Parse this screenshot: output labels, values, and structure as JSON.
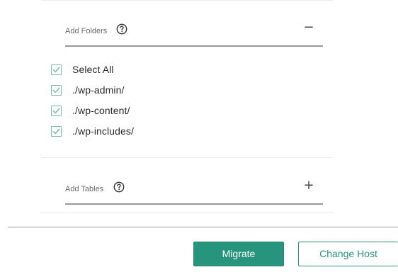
{
  "folders_section": {
    "title": "Add Folders",
    "help_icon": "help-circle-icon",
    "toggle": "−",
    "expanded": true,
    "items": [
      {
        "label": "Select All",
        "checked": true
      },
      {
        "label": "./wp-admin/",
        "checked": true
      },
      {
        "label": "./wp-content/",
        "checked": true
      },
      {
        "label": "./wp-includes/",
        "checked": true
      }
    ]
  },
  "tables_section": {
    "title": "Add Tables",
    "help_icon": "help-circle-icon",
    "toggle": "+",
    "expanded": false
  },
  "actions": {
    "migrate_label": "Migrate",
    "change_host_label": "Change Host"
  },
  "colors": {
    "accent": "#27957d",
    "checkbox_border": "#7bbfae"
  }
}
